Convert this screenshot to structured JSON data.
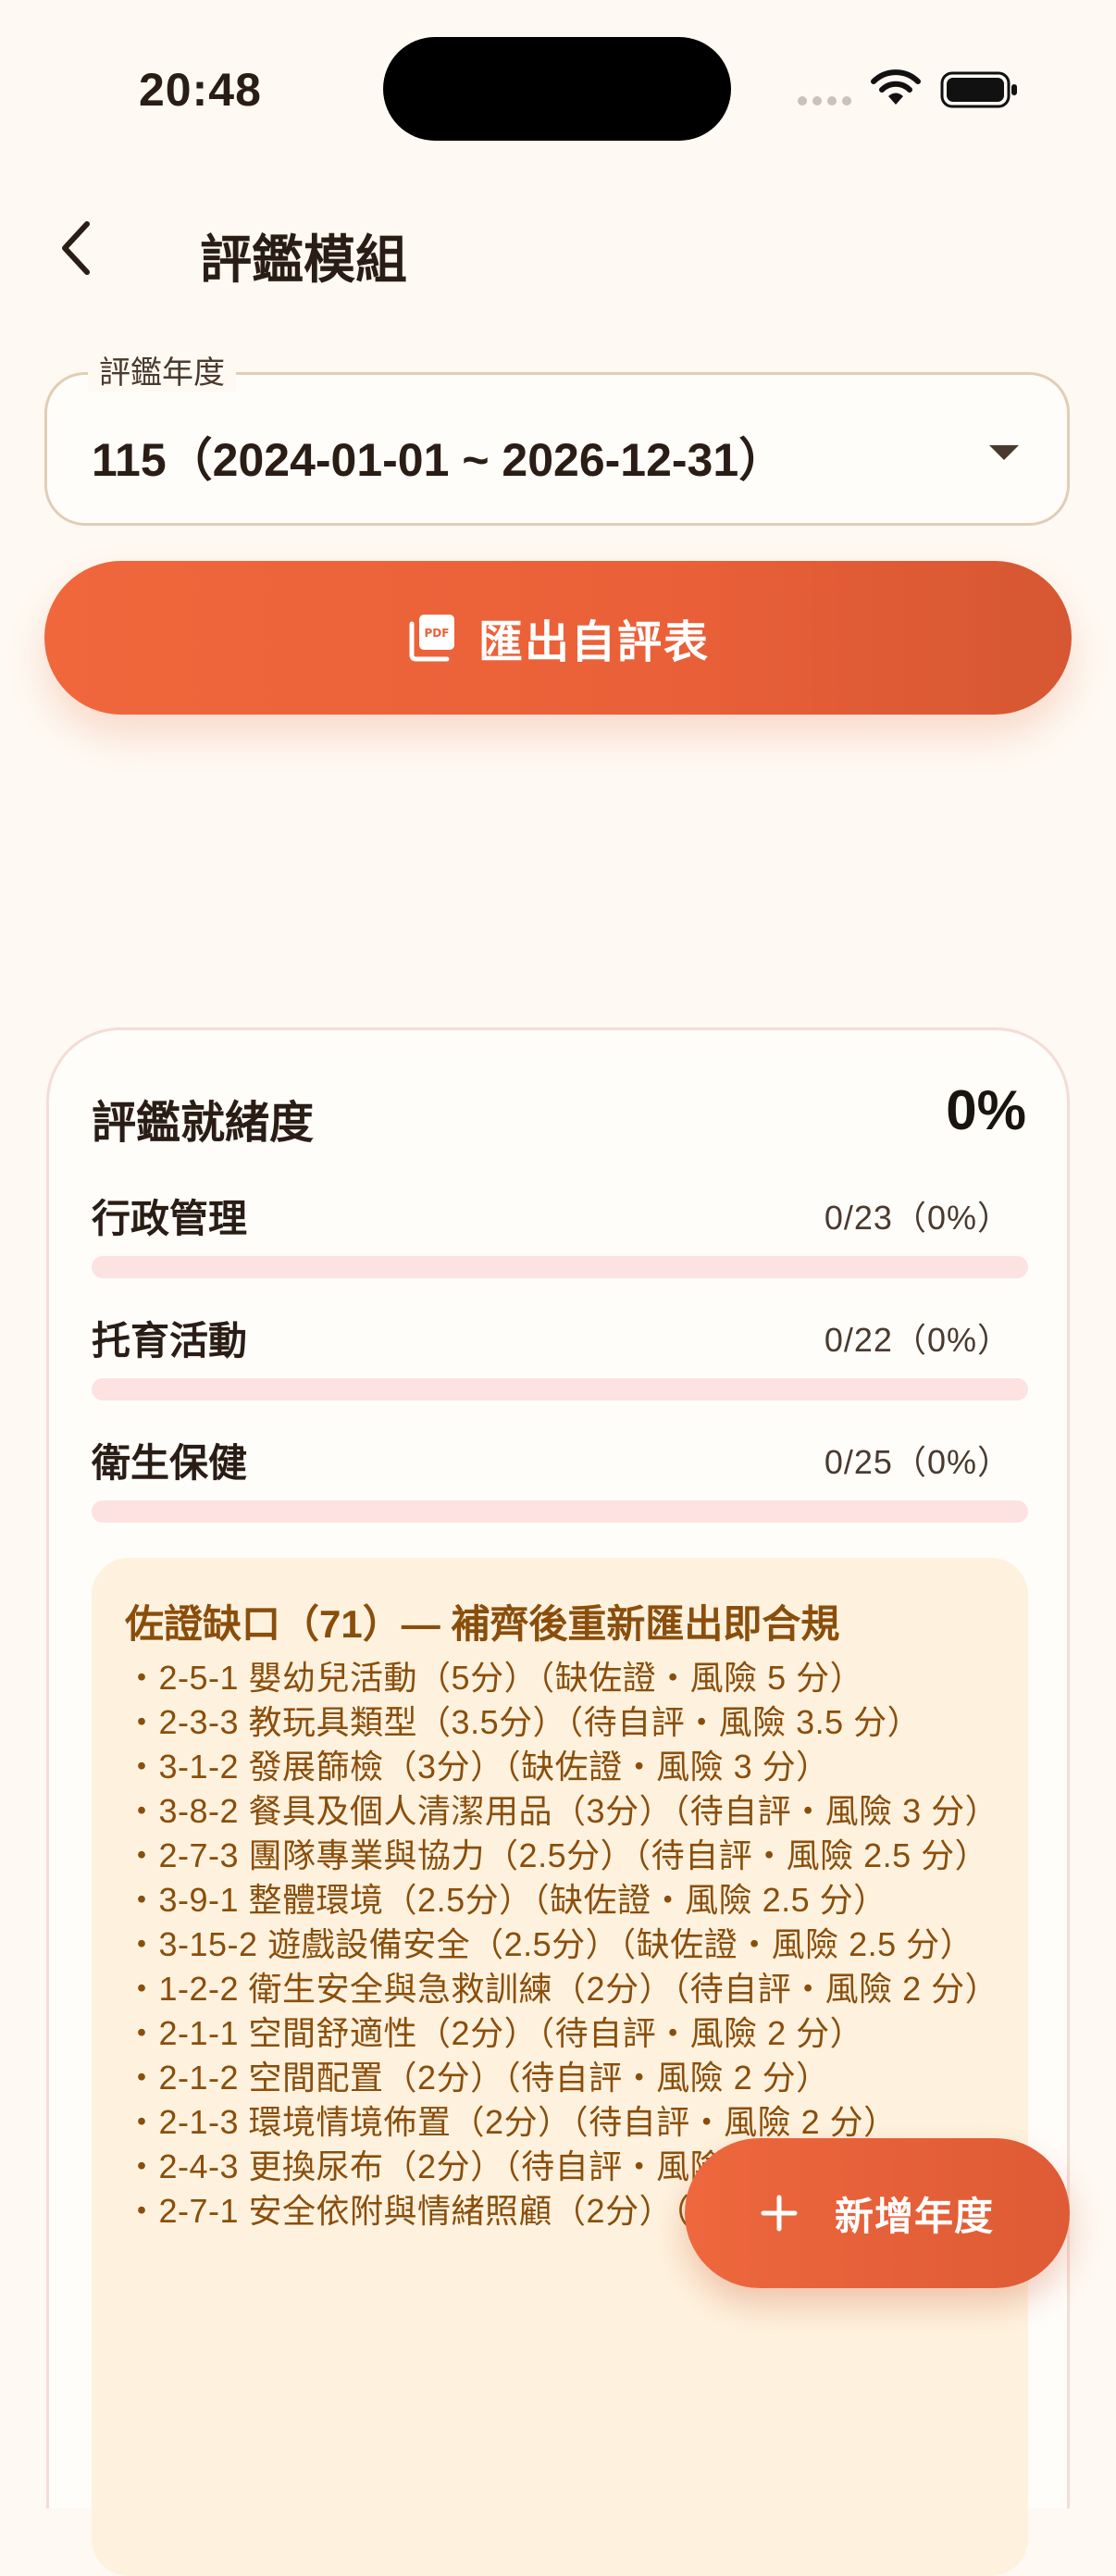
{
  "status_bar": {
    "time": "20:48"
  },
  "header": {
    "title": "評鑑模組"
  },
  "year_select": {
    "label": "評鑑年度",
    "value": "115（2024-01-01 ~ 2026-12-31）"
  },
  "export_button": {
    "label": "匯出自評表",
    "icon": "pdf-icon"
  },
  "readiness": {
    "title": "評鑑就緒度",
    "percent": "0%",
    "categories": [
      {
        "name": "行政管理",
        "count": "0/23（0%）",
        "progress": 0
      },
      {
        "name": "托育活動",
        "count": "0/22（0%）",
        "progress": 0
      },
      {
        "name": "衛生保健",
        "count": "0/25（0%）",
        "progress": 0
      }
    ]
  },
  "evidence_gap": {
    "title": "佐證缺口（71）— 補齊後重新匯出即合規",
    "items": [
      "・2-5-1 嬰幼兒活動（5分）（缺佐證・風險 5 分）",
      "・2-3-3 教玩具類型（3.5分）（待自評・風險 3.5 分）",
      "・3-1-2 發展篩檢（3分）（缺佐證・風險 3 分）",
      "・3-8-2 餐具及個人清潔用品（3分）（待自評・風險 3 分）",
      "・2-7-3 團隊專業與協力（2.5分）（待自評・風險 2.5 分）",
      "・3-9-1 整體環境（2.5分）（缺佐證・風險 2.5 分）",
      "・3-15-2 遊戲設備安全（2.5分）（缺佐證・風險 2.5 分）",
      "・1-2-2 衛生安全與急救訓練（2分）（待自評・風險 2 分）",
      "・2-1-1 空間舒適性（2分）（待自評・風險 2 分）",
      "・2-1-2 空間配置（2分）（待自評・風險 2 分）",
      "・2-1-3 環境情境佈置（2分）（待自評・風險 2 分）",
      "・2-4-3 更換尿布（2分）（待自評・風險 2 分）",
      "・2-7-1 安全依附與情緒照顧（2分）（待自評・風險 2 分）"
    ]
  },
  "fab": {
    "label": "新增年度",
    "icon": "plus-icon"
  }
}
